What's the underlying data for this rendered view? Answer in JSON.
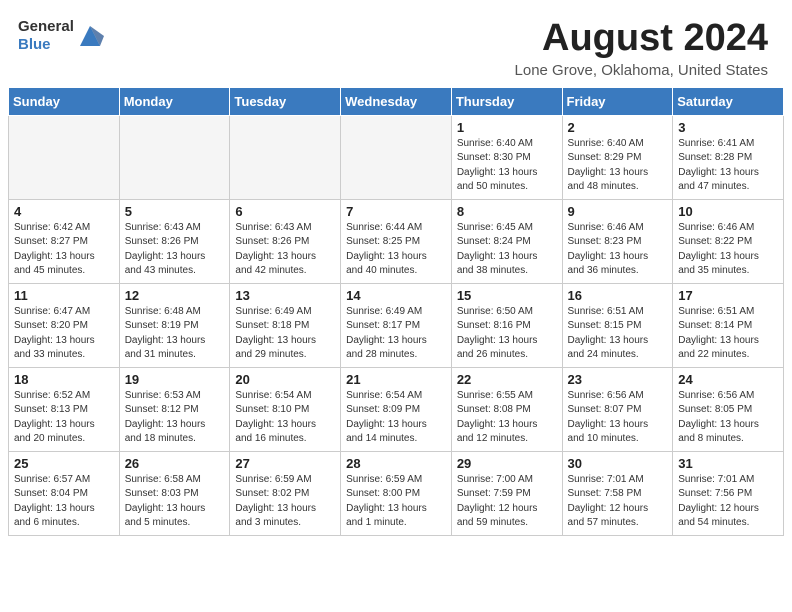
{
  "header": {
    "logo_general": "General",
    "logo_blue": "Blue",
    "month_title": "August 2024",
    "location": "Lone Grove, Oklahoma, United States"
  },
  "weekdays": [
    "Sunday",
    "Monday",
    "Tuesday",
    "Wednesday",
    "Thursday",
    "Friday",
    "Saturday"
  ],
  "weeks": [
    [
      {
        "day": "",
        "info": ""
      },
      {
        "day": "",
        "info": ""
      },
      {
        "day": "",
        "info": ""
      },
      {
        "day": "",
        "info": ""
      },
      {
        "day": "1",
        "info": "Sunrise: 6:40 AM\nSunset: 8:30 PM\nDaylight: 13 hours\nand 50 minutes."
      },
      {
        "day": "2",
        "info": "Sunrise: 6:40 AM\nSunset: 8:29 PM\nDaylight: 13 hours\nand 48 minutes."
      },
      {
        "day": "3",
        "info": "Sunrise: 6:41 AM\nSunset: 8:28 PM\nDaylight: 13 hours\nand 47 minutes."
      }
    ],
    [
      {
        "day": "4",
        "info": "Sunrise: 6:42 AM\nSunset: 8:27 PM\nDaylight: 13 hours\nand 45 minutes."
      },
      {
        "day": "5",
        "info": "Sunrise: 6:43 AM\nSunset: 8:26 PM\nDaylight: 13 hours\nand 43 minutes."
      },
      {
        "day": "6",
        "info": "Sunrise: 6:43 AM\nSunset: 8:26 PM\nDaylight: 13 hours\nand 42 minutes."
      },
      {
        "day": "7",
        "info": "Sunrise: 6:44 AM\nSunset: 8:25 PM\nDaylight: 13 hours\nand 40 minutes."
      },
      {
        "day": "8",
        "info": "Sunrise: 6:45 AM\nSunset: 8:24 PM\nDaylight: 13 hours\nand 38 minutes."
      },
      {
        "day": "9",
        "info": "Sunrise: 6:46 AM\nSunset: 8:23 PM\nDaylight: 13 hours\nand 36 minutes."
      },
      {
        "day": "10",
        "info": "Sunrise: 6:46 AM\nSunset: 8:22 PM\nDaylight: 13 hours\nand 35 minutes."
      }
    ],
    [
      {
        "day": "11",
        "info": "Sunrise: 6:47 AM\nSunset: 8:20 PM\nDaylight: 13 hours\nand 33 minutes."
      },
      {
        "day": "12",
        "info": "Sunrise: 6:48 AM\nSunset: 8:19 PM\nDaylight: 13 hours\nand 31 minutes."
      },
      {
        "day": "13",
        "info": "Sunrise: 6:49 AM\nSunset: 8:18 PM\nDaylight: 13 hours\nand 29 minutes."
      },
      {
        "day": "14",
        "info": "Sunrise: 6:49 AM\nSunset: 8:17 PM\nDaylight: 13 hours\nand 28 minutes."
      },
      {
        "day": "15",
        "info": "Sunrise: 6:50 AM\nSunset: 8:16 PM\nDaylight: 13 hours\nand 26 minutes."
      },
      {
        "day": "16",
        "info": "Sunrise: 6:51 AM\nSunset: 8:15 PM\nDaylight: 13 hours\nand 24 minutes."
      },
      {
        "day": "17",
        "info": "Sunrise: 6:51 AM\nSunset: 8:14 PM\nDaylight: 13 hours\nand 22 minutes."
      }
    ],
    [
      {
        "day": "18",
        "info": "Sunrise: 6:52 AM\nSunset: 8:13 PM\nDaylight: 13 hours\nand 20 minutes."
      },
      {
        "day": "19",
        "info": "Sunrise: 6:53 AM\nSunset: 8:12 PM\nDaylight: 13 hours\nand 18 minutes."
      },
      {
        "day": "20",
        "info": "Sunrise: 6:54 AM\nSunset: 8:10 PM\nDaylight: 13 hours\nand 16 minutes."
      },
      {
        "day": "21",
        "info": "Sunrise: 6:54 AM\nSunset: 8:09 PM\nDaylight: 13 hours\nand 14 minutes."
      },
      {
        "day": "22",
        "info": "Sunrise: 6:55 AM\nSunset: 8:08 PM\nDaylight: 13 hours\nand 12 minutes."
      },
      {
        "day": "23",
        "info": "Sunrise: 6:56 AM\nSunset: 8:07 PM\nDaylight: 13 hours\nand 10 minutes."
      },
      {
        "day": "24",
        "info": "Sunrise: 6:56 AM\nSunset: 8:05 PM\nDaylight: 13 hours\nand 8 minutes."
      }
    ],
    [
      {
        "day": "25",
        "info": "Sunrise: 6:57 AM\nSunset: 8:04 PM\nDaylight: 13 hours\nand 6 minutes."
      },
      {
        "day": "26",
        "info": "Sunrise: 6:58 AM\nSunset: 8:03 PM\nDaylight: 13 hours\nand 5 minutes."
      },
      {
        "day": "27",
        "info": "Sunrise: 6:59 AM\nSunset: 8:02 PM\nDaylight: 13 hours\nand 3 minutes."
      },
      {
        "day": "28",
        "info": "Sunrise: 6:59 AM\nSunset: 8:00 PM\nDaylight: 13 hours\nand 1 minute."
      },
      {
        "day": "29",
        "info": "Sunrise: 7:00 AM\nSunset: 7:59 PM\nDaylight: 12 hours\nand 59 minutes."
      },
      {
        "day": "30",
        "info": "Sunrise: 7:01 AM\nSunset: 7:58 PM\nDaylight: 12 hours\nand 57 minutes."
      },
      {
        "day": "31",
        "info": "Sunrise: 7:01 AM\nSunset: 7:56 PM\nDaylight: 12 hours\nand 54 minutes."
      }
    ]
  ]
}
